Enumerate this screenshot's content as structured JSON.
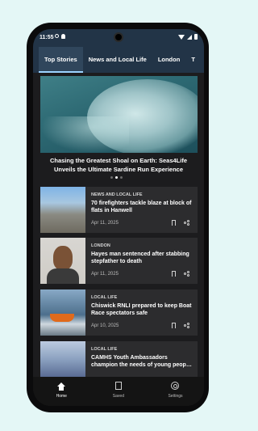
{
  "status": {
    "time": "11:55"
  },
  "tabs": [
    "Top Stories",
    "News and Local Life",
    "London",
    "T"
  ],
  "hero": {
    "title": "Chasing the Greatest Shoal on Earth: Seas4Life Unveils the Ultimate Sardine Run Experience",
    "dots": 3,
    "active_dot": 1
  },
  "articles": [
    {
      "category": "NEWS AND LOCAL LIFE",
      "headline": "70 firefighters tackle blaze at block of flats in Hanwell",
      "date": "Apr 11, 2025"
    },
    {
      "category": "LONDON",
      "headline": "Hayes man sentenced after stabbing stepfather to death",
      "date": "Apr 11, 2025"
    },
    {
      "category": "LOCAL LIFE",
      "headline": "Chiswick RNLI prepared to keep Boat Race spectators safe",
      "date": "Apr 10, 2025"
    },
    {
      "category": "LOCAL LIFE",
      "headline": "CAMHS Youth Ambassadors champion the needs of young peop…",
      "date": ""
    }
  ],
  "nav": {
    "home": "Home",
    "saved": "Saved",
    "settings": "Settings"
  },
  "icons": [
    "shield-icon",
    "bell-icon",
    "wifi-icon",
    "signal-icon",
    "battery-icon",
    "bookmark-icon",
    "share-icon",
    "home-icon",
    "saved-icon",
    "gear-icon"
  ],
  "colors": {
    "header": "#223447",
    "tab_indicator": "#9cd3ff",
    "background": "#e4f7f6"
  }
}
